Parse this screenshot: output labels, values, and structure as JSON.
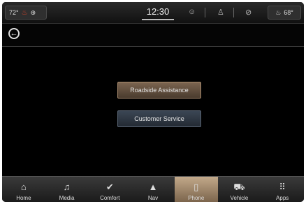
{
  "status_bar": {
    "left_temp": "72°",
    "right_temp": "68°",
    "clock": "12:30"
  },
  "main": {
    "roadside_label": "Roadside Assistance",
    "service_label": "Customer Service"
  },
  "nav": {
    "active": "Phone",
    "items": [
      {
        "label": "Home",
        "icon": "home-icon"
      },
      {
        "label": "Media",
        "icon": "music-note-icon"
      },
      {
        "label": "Comfort",
        "icon": "seat-heat-icon"
      },
      {
        "label": "Nav",
        "icon": "navigation-arrow-icon"
      },
      {
        "label": "Phone",
        "icon": "phone-icon"
      },
      {
        "label": "Vehicle",
        "icon": "car-icon"
      },
      {
        "label": "Apps",
        "icon": "apps-grid-icon"
      }
    ]
  },
  "colors": {
    "active_nav": "#a58c6f",
    "roadside_button": "#6b5643",
    "service_button": "#303a46"
  }
}
